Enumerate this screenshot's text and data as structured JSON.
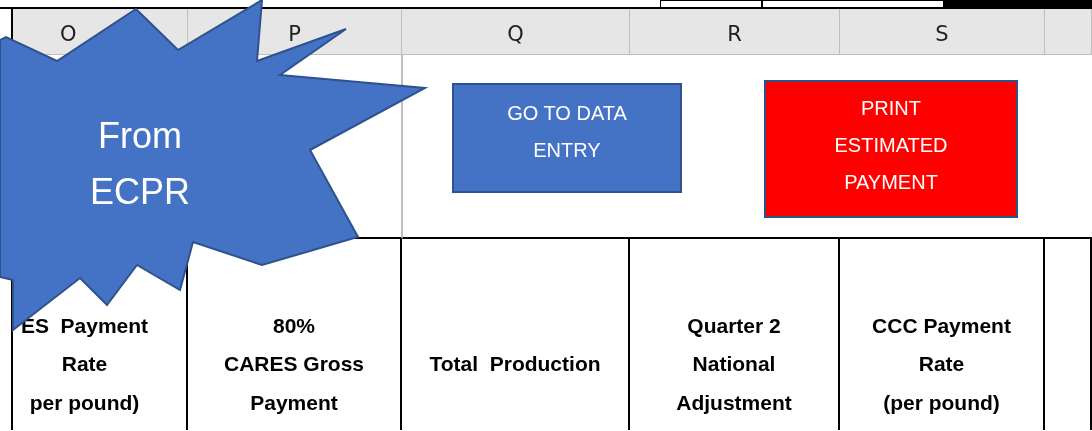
{
  "column_headers": [
    {
      "label": "O"
    },
    {
      "label": "P"
    },
    {
      "label": "Q"
    },
    {
      "label": "R"
    },
    {
      "label": "S"
    }
  ],
  "callout": {
    "lines": [
      "From",
      "ECPR"
    ]
  },
  "buttons": [
    {
      "lines": [
        "GO TO DATA",
        "ENTRY"
      ],
      "color": "#4472c4"
    },
    {
      "lines": [
        "PRINT",
        "ESTIMATED",
        "PAYMENT"
      ],
      "color": "#ff0000"
    }
  ],
  "header_cells": [
    {
      "lines": [
        "ES  Payment",
        "Rate",
        "per pound)"
      ]
    },
    {
      "lines": [
        "80%",
        "CARES Gross",
        "Payment"
      ]
    },
    {
      "lines": [
        "Total  Production"
      ]
    },
    {
      "lines": [
        "Quarter 2",
        "National",
        "Adjustment"
      ]
    },
    {
      "lines": [
        "CCC Payment",
        "Rate",
        "(per pound)"
      ]
    }
  ]
}
